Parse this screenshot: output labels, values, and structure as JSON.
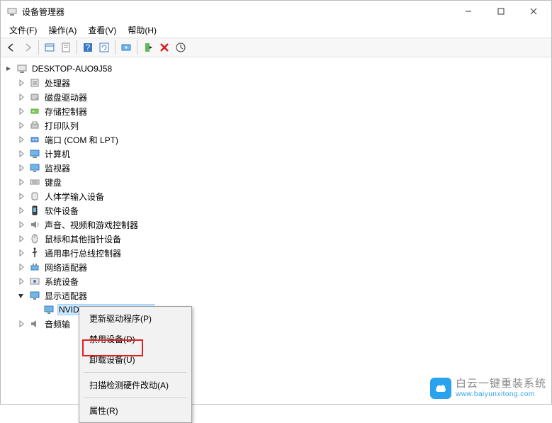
{
  "window": {
    "title": "设备管理器"
  },
  "window_controls": {
    "minimize": "—",
    "maximize": "▢",
    "close": "✕"
  },
  "menu": {
    "file": "文件(F)",
    "action": "操作(A)",
    "view": "查看(V)",
    "help": "帮助(H)"
  },
  "toolbar_icons": {
    "back": "back-icon",
    "forward": "forward-icon",
    "show_hidden": "show-hidden-icon",
    "props": "properties-icon",
    "help": "help-icon",
    "refresh": "refresh-icon",
    "monitor": "monitor-icon",
    "add": "add-hardware-icon",
    "remove": "remove-icon",
    "scan": "scan-icon"
  },
  "tree": {
    "root": "DESKTOP-AUO9J58",
    "categories": [
      {
        "label": "处理器",
        "icon": "cpu-icon"
      },
      {
        "label": "磁盘驱动器",
        "icon": "disk-icon"
      },
      {
        "label": "存储控制器",
        "icon": "storage-icon"
      },
      {
        "label": "打印队列",
        "icon": "printer-icon"
      },
      {
        "label": "端口 (COM 和 LPT)",
        "icon": "port-icon"
      },
      {
        "label": "计算机",
        "icon": "computer-icon"
      },
      {
        "label": "监视器",
        "icon": "monitor-icon"
      },
      {
        "label": "键盘",
        "icon": "keyboard-icon"
      },
      {
        "label": "人体学输入设备",
        "icon": "hid-icon"
      },
      {
        "label": "软件设备",
        "icon": "software-icon"
      },
      {
        "label": "声音、视频和游戏控制器",
        "icon": "audio-icon"
      },
      {
        "label": "鼠标和其他指针设备",
        "icon": "mouse-icon"
      },
      {
        "label": "通用串行总线控制器",
        "icon": "usb-icon"
      },
      {
        "label": "网络适配器",
        "icon": "network-icon"
      },
      {
        "label": "系统设备",
        "icon": "system-icon"
      }
    ],
    "display_adapters": {
      "label": "显示适配器",
      "icon": "display-icon",
      "expanded": true
    },
    "nvidia": {
      "label": "NVIDIA GeForce GT 730",
      "icon": "gpu-icon"
    },
    "audio_inputs": {
      "label": "音频输",
      "icon": "audio-in-icon"
    }
  },
  "context_menu": {
    "update": "更新驱动程序(P)",
    "disable": "禁用设备(D)",
    "uninstall": "卸载设备(U)",
    "scan": "扫描检测硬件改动(A)",
    "properties": "属性(R)"
  },
  "watermark": {
    "title": "白云一键重装系统",
    "url": "www.baiyunxitong.com"
  }
}
